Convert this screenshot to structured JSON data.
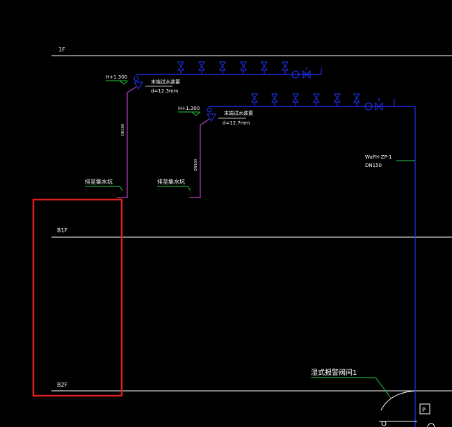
{
  "colors": {
    "background": "#000000",
    "floor_line": "#ffffff",
    "pipe_blue": "#2233ff",
    "pipe_magenta": "#c040c0",
    "leader_green": "#22cc44",
    "selection_red": "#e02020"
  },
  "floors": [
    {
      "label": "1F"
    },
    {
      "label": "B1F"
    },
    {
      "label": "B2F"
    }
  ],
  "pipes": {
    "upper_elevation": "H+1.300",
    "lower_elevation": "H+1.300",
    "upper_valve_label": "末端试水装置",
    "upper_valve_dim": "d=12.3mm",
    "lower_valve_label": "末端试水装置",
    "lower_valve_dim": "d=12.7mm",
    "upper_drain_size": "DN100",
    "lower_drain_size": "DN100",
    "upper_drain_note": "排至集水坑",
    "lower_drain_note": "排至集水坑",
    "riser_id": "WaFH-ZP-1",
    "riser_size": "DN150",
    "alarm_valve_label": "湿式报警阀间1",
    "p_tag": "P"
  }
}
